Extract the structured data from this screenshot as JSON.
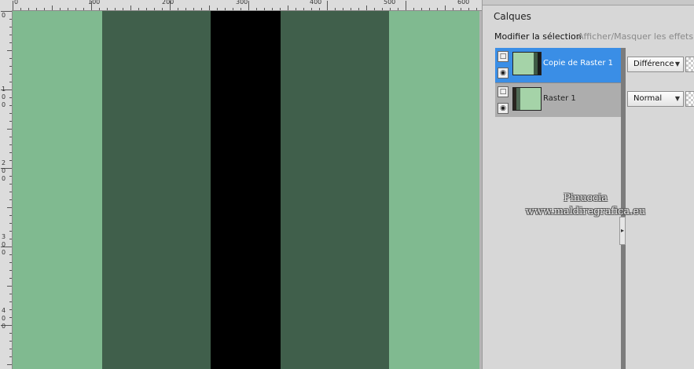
{
  "canvas": {
    "ruler_top_labels": [
      "0",
      "100",
      "200",
      "300",
      "400",
      "500",
      "600"
    ],
    "ruler_left_labels": [
      [
        "0"
      ],
      [
        "1",
        "0",
        "0"
      ],
      [
        "2",
        "0",
        "0"
      ],
      [
        "3",
        "0",
        "0"
      ],
      [
        "4",
        "0",
        "0"
      ]
    ],
    "stripes": [
      {
        "color": "#80ba90",
        "width": 114
      },
      {
        "color": "#405f4b",
        "width": 138
      },
      {
        "color": "#000000",
        "width": 89
      },
      {
        "color": "#405f4b",
        "width": 138
      },
      {
        "color": "#80ba90",
        "width": 115
      }
    ]
  },
  "panel": {
    "title": "Calques",
    "toolbar": {
      "modify_selection": "Modifier la sélection",
      "toggle_effects": "Afficher/Masquer les effets de"
    },
    "layers": [
      {
        "name": "Copie de Raster 1",
        "blend_mode": "Différence",
        "selected": true,
        "visible_icon": "eye-icon",
        "type_icon": "raster-layer-icon",
        "thumbnail": [
          {
            "color": "#a5d3a8",
            "flex": 6
          },
          {
            "color": "#3f5a45",
            "flex": 1
          },
          {
            "color": "#1a1a1a",
            "flex": 1
          }
        ]
      },
      {
        "name": "Raster 1",
        "blend_mode": "Normal",
        "selected": false,
        "visible_icon": "eye-icon",
        "type_icon": "raster-layer-icon",
        "thumbnail": [
          {
            "color": "#2a2520",
            "flex": 1
          },
          {
            "color": "#4f6a55",
            "flex": 1
          },
          {
            "color": "#a5d3a8",
            "flex": 6
          }
        ]
      }
    ]
  },
  "watermark": {
    "line1": "Pinuccia",
    "line2": "www.maldiregrafica.eu"
  },
  "colors": {
    "accent_selected": "#3a8ee6"
  }
}
